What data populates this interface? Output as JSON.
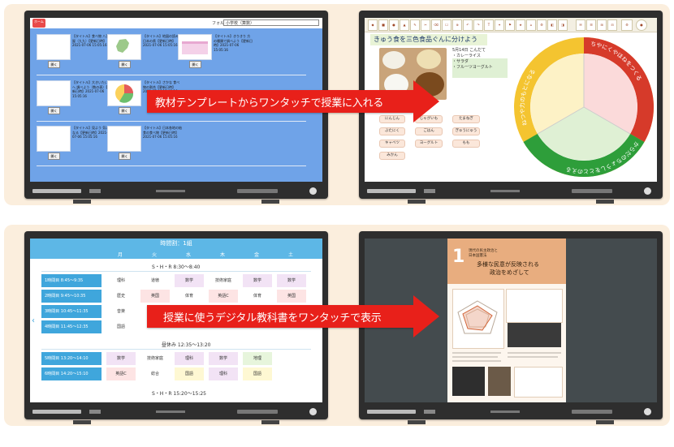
{
  "top_arrow": {
    "text": "教材テンプレートからワンタッチで授業に入れる"
  },
  "bottom_arrow": {
    "text": "授業に使うデジタル教科書をワンタッチで表示"
  },
  "screen1": {
    "logo": "ホーム",
    "dropdown_label": "フォルダ",
    "dropdown_value": "小学校（算数）",
    "cards": [
      {
        "text": "【タイトル】食べ物 八百屋（九九）【更新日時】2021-07-06 15:05:16",
        "button": "開く"
      },
      {
        "text": "【タイトル】地図の読み方 日本の県【更新日時】2021-07-06 15:05:16",
        "button": "開く"
      },
      {
        "text": "【タイトル】きりきり 方の種類で調べよう【更新日時】2021-07-06 15:05:16",
        "button": "開く"
      },
      {
        "text": "【タイトル】大きいたい方へ 調べよう（数の表）【更新日時】2021-07-06 15:05:16",
        "button": "開く"
      },
      {
        "text": "【タイトル】さかな 食べ物の割合【更新日時】2021-07-06 15:05:16",
        "button": "開く"
      },
      {
        "text": "【タイトル】見よう 気になる【更新日時】2021-07-06 15:05:16",
        "button": "開く"
      },
      {
        "text": "【タイトル】字名のべんりで作られている【更新日時】2021-07-06 15:05:16",
        "button": "開く"
      },
      {
        "text": "【タイトル】日本各地の給食の食べ物【更新日時】2021-07-06 15:05:16",
        "button": "開く"
      }
    ]
  },
  "screen2": {
    "title": "きゅう食を三色食品ぐんに分けよう",
    "note_lines": [
      "5月14日 こんだて",
      "・カレーライス",
      "・サラダ",
      "・フルーツヨーグルト"
    ],
    "chips": [
      "にんじん",
      "じゃがいも",
      "たまねぎ",
      "ぶたにく",
      "ごはん",
      "ぎゅうにゅう",
      "キャベツ",
      "ヨーグルト",
      "もも",
      "みかん"
    ],
    "wheel_label_red": "ちやにくやほねをつくる",
    "wheel_label_yellow": "ねつや力のもとになる",
    "wheel_label_green": "からだのちょうしをととのえる"
  },
  "screen3": {
    "header": "時間割：1組",
    "days": [
      "月",
      "火",
      "水",
      "木",
      "金",
      "土"
    ],
    "shr_morning": "S・H・R 8:30〜8:40",
    "periods": [
      {
        "label": "1時間目",
        "time": "8:45〜9:35",
        "cells": [
          "理科",
          "道徳",
          "数学",
          "技術家庭",
          "数学",
          "数学"
        ]
      },
      {
        "label": "2時間目",
        "time": "9:45〜10:35",
        "cells": [
          "歴史",
          "英国",
          "体育",
          "英語C",
          "体育",
          "英国"
        ]
      },
      {
        "label": "3時間目",
        "time": "10:45〜11:35",
        "cells": [
          "音楽",
          "",
          "",
          "",
          "",
          ""
        ]
      },
      {
        "label": "4時間目",
        "time": "11:45〜12:35",
        "cells": [
          "国語",
          "",
          "",
          "",
          "",
          ""
        ]
      },
      {
        "label": "5時間目",
        "time": "13:20〜14:10",
        "cells": [
          "数学",
          "技術家庭",
          "理科",
          "数学",
          "地理",
          ""
        ]
      },
      {
        "label": "6時間目",
        "time": "14:20〜15:10",
        "cells": [
          "英語C",
          "総合",
          "国語",
          "理科",
          "国語",
          ""
        ]
      }
    ],
    "lunch": "昼休み 12:35〜13:20",
    "shr_evening": "S・H・R 15:20〜15:25"
  },
  "screen4": {
    "number": "1",
    "sub1": "現代の民主政治と",
    "sub2": "日本国憲法",
    "h1": "多様な民意が反映される",
    "h2": "政治をめざして"
  },
  "colors": {
    "panel": "#fbeedd",
    "arrow": "#e8201a",
    "screen1_bg": "#6fa3e8",
    "timetable_head": "#5db7e6"
  }
}
